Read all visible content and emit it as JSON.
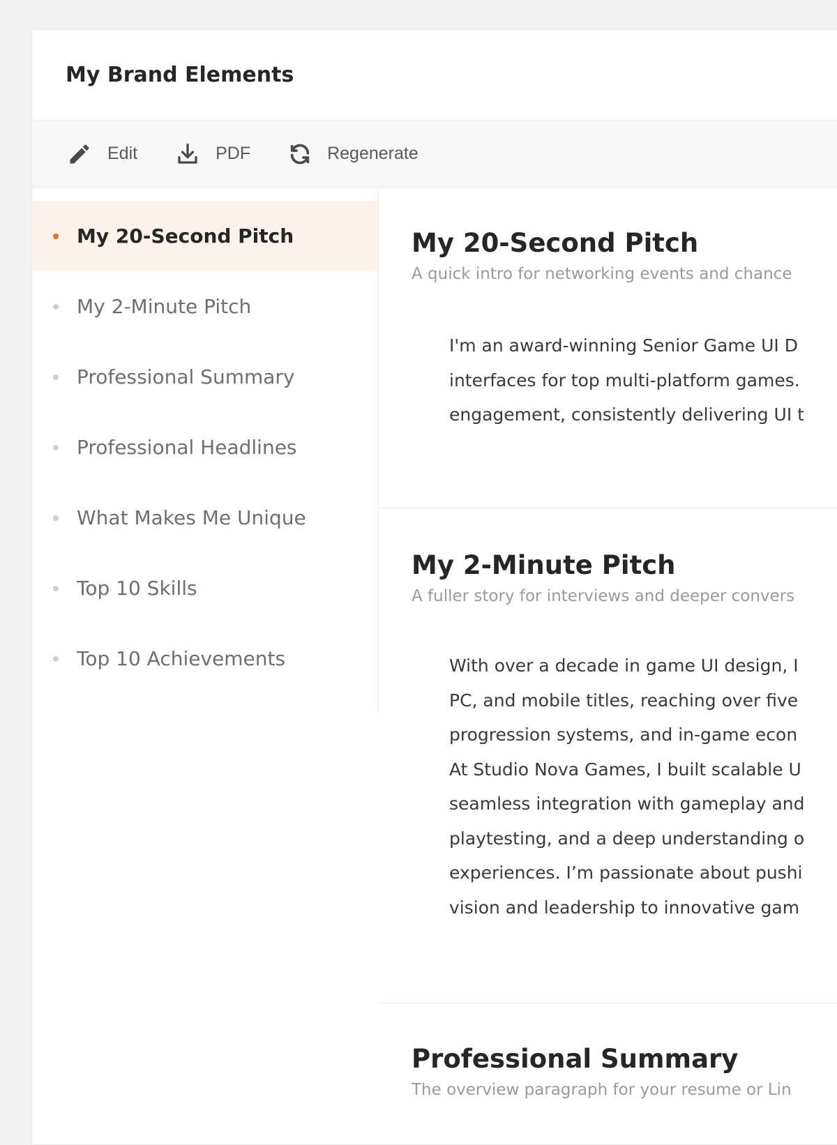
{
  "header": {
    "title": "My Brand Elements"
  },
  "toolbar": {
    "edit_label": "Edit",
    "pdf_label": "PDF",
    "regenerate_label": "Regenerate",
    "icons": {
      "edit": "pencil-icon",
      "pdf": "download-icon",
      "regenerate": "refresh-icon"
    }
  },
  "colors": {
    "accent": "#f06a1f",
    "active_bg": "#fdf1ec"
  },
  "sidebar": {
    "items": [
      {
        "label": "My 20-Second Pitch",
        "active": true
      },
      {
        "label": "My 2-Minute Pitch",
        "active": false
      },
      {
        "label": "Professional Summary",
        "active": false
      },
      {
        "label": "Professional Headlines",
        "active": false
      },
      {
        "label": "What Makes Me Unique",
        "active": false
      },
      {
        "label": "Top 10 Skills",
        "active": false
      },
      {
        "label": "Top 10 Achievements",
        "active": false
      }
    ]
  },
  "sections": [
    {
      "title": "My 20-Second Pitch",
      "subtitle": "A quick intro for networking events and chance",
      "body": "I'm an award-winning Senior Game UI D\ninterfaces for top multi-platform games.\nengagement, consistently delivering UI t"
    },
    {
      "title": "My 2-Minute Pitch",
      "subtitle": "A fuller story for interviews and deeper convers",
      "body": "With over a decade in game UI design, I\nPC, and mobile titles, reaching over five\nprogression systems, and in-game econ\nAt Studio Nova Games, I built scalable U\nseamless integration with gameplay and\nplaytesting, and a deep understanding o\nexperiences. I’m passionate about pushi\nvision and leadership to innovative gam"
    },
    {
      "title": "Professional Summary",
      "subtitle": "The overview paragraph for your resume or Lin"
    }
  ]
}
